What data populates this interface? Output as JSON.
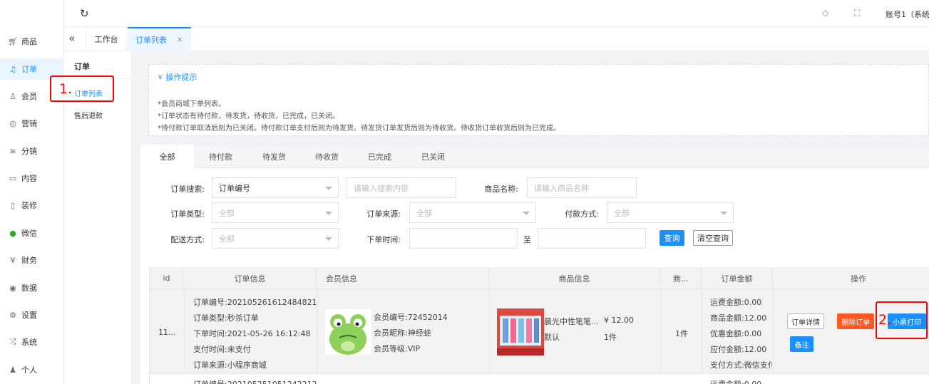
{
  "topbar": {
    "account": "账号1（系统"
  },
  "sidebar": {
    "items": [
      {
        "label": "商品",
        "icon": "cart-icon"
      },
      {
        "label": "订单",
        "icon": "bell-icon"
      },
      {
        "label": "会员",
        "icon": "user-icon"
      },
      {
        "label": "营销",
        "icon": "target-icon"
      },
      {
        "label": "分销",
        "icon": "layers-icon"
      },
      {
        "label": "内容",
        "icon": "book-icon"
      },
      {
        "label": "装修",
        "icon": "phone-icon"
      },
      {
        "label": "微信",
        "icon": "wechat-icon"
      },
      {
        "label": "财务",
        "icon": "yen-icon"
      },
      {
        "label": "数据",
        "icon": "data-icon"
      },
      {
        "label": "设置",
        "icon": "gear-icon"
      },
      {
        "label": "系统",
        "icon": "system-icon"
      },
      {
        "label": "个人",
        "icon": "person-icon"
      }
    ]
  },
  "tabs": {
    "workbench": "工作台",
    "order_list": "订单列表"
  },
  "subnav": {
    "title": "订单",
    "items": [
      "订单列表",
      "售后退款"
    ]
  },
  "annotations": {
    "one": "1.",
    "two": "2."
  },
  "tips": {
    "title": "操作提示",
    "lines": [
      "*会员商城下单列表。",
      "*订单状态有待付款，待发货，待收货，已完成，已关闭。",
      "*待付款订单取消后则为已关闭。待付款订单支付后则为待发货。待发货订单发货后则为待收货。待收货订单收货后则为已完成。"
    ]
  },
  "status_tabs": [
    "全部",
    "待付款",
    "待发货",
    "待收货",
    "已完成",
    "已关闭"
  ],
  "filters": {
    "search_label": "订单搜索:",
    "search_type": "订单编号",
    "search_placeholder": "请输入搜索内容",
    "goods_label": "商品名称:",
    "goods_placeholder": "请输入商品名称",
    "type_label": "订单类型:",
    "type_value": "全部",
    "source_label": "订单来源:",
    "source_value": "全部",
    "pay_label": "付款方式:",
    "pay_value": "全部",
    "delivery_label": "配送方式:",
    "delivery_value": "全部",
    "time_label": "下单时间:",
    "to": "至",
    "query_btn": "查询",
    "clear_btn": "清空查询"
  },
  "table": {
    "headers": [
      "id",
      "订单信息",
      "会员信息",
      "商品信息",
      "商...",
      "订单金额",
      "操作"
    ],
    "row": {
      "id": "11...",
      "order_lines": [
        "订单编号:202105261612484821",
        "订单类型:秒杀订单",
        "下单时间:2021-05-26 16:12:48",
        "支付时间:未支付",
        "订单来源:小程序商城"
      ],
      "member_lines": [
        "会员编号:72452014",
        "会员昵称:神经蛙",
        "会员等级:VIP"
      ],
      "goods_name": "晨光中性笔笔...",
      "goods_price": "¥ 12.00",
      "goods_spec": "默认",
      "goods_qty": "1件",
      "count": "1件",
      "amount_lines": [
        "运费金额:0.00",
        "商品金额:12.00",
        "优惠金额:0.00",
        "应付金额:12.00",
        "支付方式:微信支付"
      ],
      "actions": {
        "detail": "订单详情",
        "delete": "删除订单",
        "print": "小票打印",
        "remark": "备注"
      }
    },
    "next_row_partial": "订单编号:202105251051242212",
    "next_amount_partial": "运费金额:0.00"
  },
  "colors": {
    "primary": "#1890ff",
    "danger": "#ff5722",
    "annotation": "#ff0000"
  }
}
